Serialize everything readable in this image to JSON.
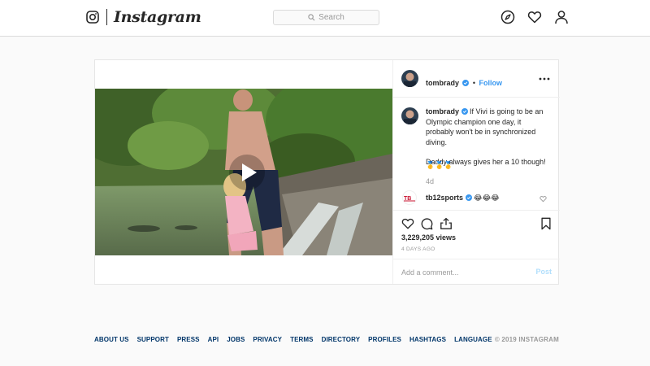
{
  "nav": {
    "logo_text": "Instagram",
    "search_placeholder": "Search"
  },
  "post": {
    "username": "tomb​rady",
    "follow_separator": "•",
    "follow_label": "Follow",
    "caption_lines": [
      "If Vivi is going to be an",
      "Olympic champion one day, it",
      "probably won't be in synchronized",
      "diving."
    ],
    "caption_line2": "Daddy always gives her a 10 though!",
    "medals": "🥇🥇🥇",
    "time_ago": "4d",
    "comment": {
      "username": "tb12sports",
      "text": "😂😂😂"
    },
    "views": "3,229,205 views",
    "posted": "4 DAYS AGO",
    "comment_placeholder": "Add a comment...",
    "post_label": "Post"
  },
  "footer": {
    "links": [
      "ABOUT US",
      "SUPPORT",
      "PRESS",
      "API",
      "JOBS",
      "PRIVACY",
      "TERMS",
      "DIRECTORY",
      "PROFILES",
      "HASHTAGS",
      "LANGUAGE"
    ],
    "copyright": "© 2019 INSTAGRAM"
  },
  "colors": {
    "link_blue": "#3897f0",
    "footer_link": "#003569",
    "border": "#dbdbdb",
    "muted": "#999999"
  },
  "icons": [
    "instagram-glyph-icon",
    "search-icon",
    "explore-compass-icon",
    "heart-icon",
    "profile-icon",
    "verified-badge-icon",
    "more-options-icon",
    "play-icon",
    "like-icon",
    "comment-icon",
    "share-icon",
    "bookmark-icon"
  ]
}
